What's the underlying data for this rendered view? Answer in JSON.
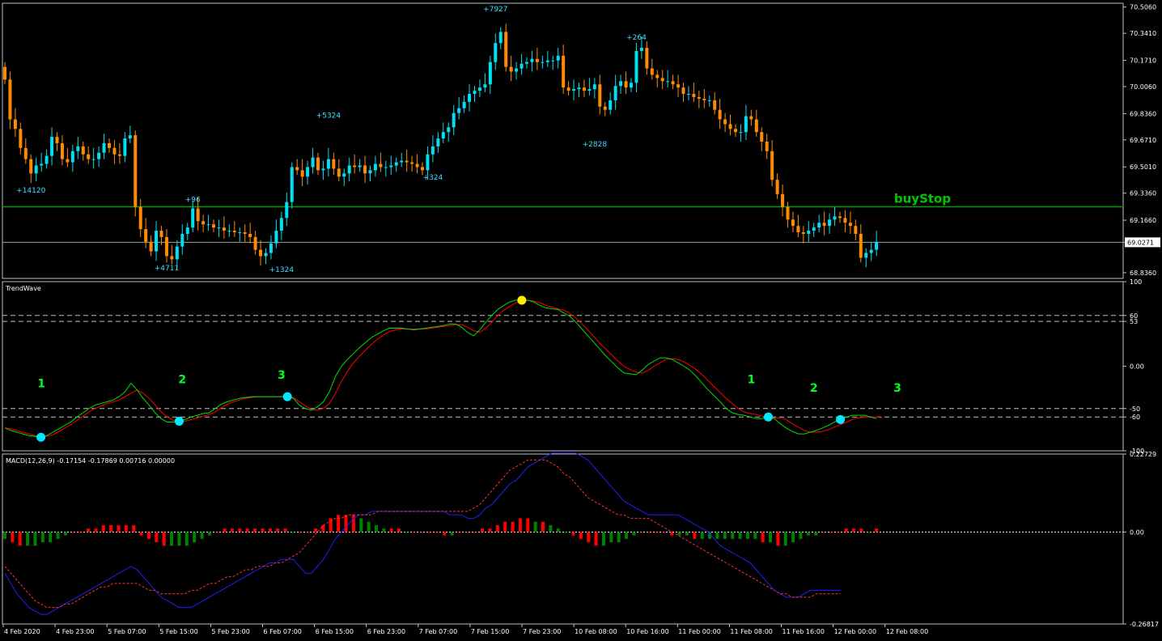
{
  "window": {
    "symbol_label": "EURRUB.ffx,H1  69.0034 69.0912 69.0032 69.0271"
  },
  "colors": {
    "bull": "#00e0f0",
    "bear": "#ff8c00",
    "grid": "#c0c0c0",
    "buystop": "#00a000",
    "trend_green": "#00e000",
    "trend_red": "#ff0000",
    "macd_blue": "#2020ff",
    "macd_red": "#ff3030",
    "hist_green": "#008000",
    "hist_red": "#ff0000",
    "dot_cyan": "#00e8ff",
    "dot_yellow": "#ffee00",
    "wave_label": "#00ff20"
  },
  "price_panel": {
    "ticks": [
      "70.5060",
      "70.3410",
      "70.1710",
      "70.0060",
      "69.8360",
      "69.6710",
      "69.5010",
      "69.3360",
      "69.1660",
      "69.0271",
      "68.8360"
    ],
    "ylim": [
      68.8,
      70.53
    ],
    "current_price": 69.0271,
    "current_label": "69.0271",
    "buystop_price": 69.25,
    "buystop_label": "buyStop",
    "trade_labels": [
      {
        "text": "+14120",
        "price": 69.34,
        "bar": 5
      },
      {
        "text": "+96",
        "price": 69.28,
        "bar": 36
      },
      {
        "text": "+4711",
        "price": 68.85,
        "bar": 31
      },
      {
        "text": "+1324",
        "price": 68.84,
        "bar": 53
      },
      {
        "text": "+5324",
        "price": 69.81,
        "bar": 62
      },
      {
        "text": "+324",
        "price": 69.42,
        "bar": 82
      },
      {
        "text": "+7927",
        "price": 70.48,
        "bar": 94
      },
      {
        "text": "+264",
        "price": 70.3,
        "bar": 121
      },
      {
        "text": "+2828",
        "price": 69.63,
        "bar": 113
      }
    ]
  },
  "trendwave_panel": {
    "title": "TrendWave",
    "ticks": [
      "100",
      "60",
      "53",
      "0.00",
      "-50",
      "-60",
      "-100"
    ],
    "ylim": [
      -100,
      100
    ],
    "levels": [
      60,
      53,
      -50,
      -60
    ],
    "wave_labels": [
      {
        "text": "1",
        "bar": 7,
        "value": -25
      },
      {
        "text": "2",
        "bar": 34,
        "value": -20
      },
      {
        "text": "3",
        "bar": 53,
        "value": -15
      },
      {
        "text": "1",
        "bar": 143,
        "value": -20
      },
      {
        "text": "2",
        "bar": 155,
        "value": -30
      },
      {
        "text": "3",
        "bar": 171,
        "value": -30
      }
    ]
  },
  "macd_panel": {
    "title": "MACD(12,26,9) -0.17154 -0.17869 0.00716 0.00000",
    "ticks": [
      "0.22729",
      "0.00",
      "-0.26817"
    ],
    "ylim": [
      -0.26817,
      0.22729
    ]
  },
  "x_axis": {
    "labels": [
      "4 Feb 2020",
      "4 Feb 23:00",
      "5 Feb 07:00",
      "5 Feb 15:00",
      "5 Feb 23:00",
      "6 Feb 07:00",
      "6 Feb 15:00",
      "6 Feb 23:00",
      "7 Feb 07:00",
      "7 Feb 15:00",
      "7 Feb 23:00",
      "10 Feb 08:00",
      "10 Feb 16:00",
      "11 Feb 00:00",
      "11 Feb 08:00",
      "11 Feb 16:00",
      "12 Feb 00:00",
      "12 Feb 08:00"
    ]
  },
  "chart_data": [
    {
      "type": "candlestick",
      "title": "EURRUB.ffx,H1  69.0034 69.0912 69.0032 69.0271",
      "ylim": [
        68.8,
        70.53
      ],
      "close": [
        70.05,
        69.8,
        69.74,
        69.62,
        69.55,
        69.46,
        69.51,
        69.52,
        69.57,
        69.69,
        69.65,
        69.55,
        69.53,
        69.6,
        69.63,
        69.58,
        69.55,
        69.55,
        69.59,
        69.65,
        69.62,
        69.58,
        69.57,
        69.68,
        69.7,
        69.25,
        69.11,
        69.03,
        68.97,
        69.1,
        69.06,
        68.94,
        68.92,
        69.0,
        69.08,
        69.12,
        69.24,
        69.16,
        69.14,
        69.14,
        69.12,
        69.12,
        69.1,
        69.1,
        69.09,
        69.09,
        69.08,
        69.06,
        68.98,
        68.94,
        68.96,
        69.02,
        69.1,
        69.18,
        69.28,
        69.5,
        69.48,
        69.44,
        69.5,
        69.56,
        69.48,
        69.49,
        69.55,
        69.49,
        69.44,
        69.46,
        69.51,
        69.5,
        69.51,
        69.46,
        69.48,
        69.52,
        69.5,
        69.5,
        69.51,
        69.53,
        69.54,
        69.53,
        69.52,
        69.5,
        69.48,
        69.58,
        69.63,
        69.68,
        69.72,
        69.75,
        69.84,
        69.87,
        69.91,
        69.96,
        69.98,
        70.0,
        70.02,
        70.16,
        70.28,
        70.35,
        70.13,
        70.1,
        70.12,
        70.15,
        70.16,
        70.18,
        70.16,
        70.16,
        70.17,
        70.17,
        70.2,
        70.0,
        69.98,
        69.99,
        70.0,
        69.98,
        69.99,
        70.02,
        69.88,
        69.86,
        69.92,
        70.01,
        70.04,
        70.0,
        70.03,
        70.23,
        70.25,
        70.12,
        70.08,
        70.06,
        70.04,
        70.04,
        70.02,
        70.0,
        69.96,
        69.96,
        69.94,
        69.93,
        69.92,
        69.92,
        69.86,
        69.8,
        69.77,
        69.74,
        69.72,
        69.72,
        69.82,
        69.8,
        69.72,
        69.66,
        69.6,
        69.42,
        69.33,
        69.25,
        69.17,
        69.13,
        69.09,
        69.08,
        69.1,
        69.12,
        69.15,
        69.13,
        69.17,
        69.19,
        69.18,
        69.15,
        69.13,
        69.08,
        68.93,
        68.96,
        68.98,
        69.03
      ],
      "series": [
        {
          "name": "TrendWave green",
          "values": [
            -73,
            -76,
            -78,
            -80,
            -82,
            -83,
            -84,
            -82,
            -78,
            -74,
            -70,
            -66,
            -60,
            -55,
            -50,
            -46,
            -44,
            -42,
            -40,
            -36,
            -30,
            -20,
            -28,
            -38,
            -46,
            -55,
            -62,
            -66,
            -66,
            -65,
            -63,
            -60,
            -58,
            -56,
            -55,
            -50,
            -45,
            -42,
            -40,
            -38,
            -37,
            -36,
            -36,
            -36,
            -36,
            -36,
            -36,
            -36,
            -38,
            -46,
            -50,
            -52,
            -48,
            -42,
            -30,
            -12,
            0,
            8,
            15,
            22,
            28,
            34,
            38,
            42,
            45,
            45,
            45,
            44,
            43,
            44,
            45,
            46,
            47,
            48,
            50,
            50,
            46,
            40,
            36,
            43,
            52,
            60,
            67,
            72,
            76,
            78,
            78,
            78,
            76,
            72,
            69,
            68,
            67,
            63,
            59,
            52,
            44,
            36,
            28,
            20,
            12,
            5,
            -2,
            -8,
            -9,
            -10,
            -5,
            2,
            6,
            10,
            10,
            8,
            4,
            0,
            -5,
            -12,
            -20,
            -28,
            -35,
            -42,
            -50,
            -55,
            -57,
            -58,
            -60,
            -62,
            -62,
            -60,
            -62,
            -68,
            -73,
            -77,
            -80,
            -80,
            -78,
            -76,
            -73,
            -70,
            -66,
            -63,
            -60,
            -58,
            -58,
            -58,
            -60,
            -62
          ],
          "color": "#00e000"
        },
        {
          "name": "TrendWave red",
          "values": [
            -73,
            -74,
            -76,
            -78,
            -80,
            -82,
            -82,
            -83,
            -81,
            -77,
            -73,
            -69,
            -64,
            -59,
            -54,
            -50,
            -47,
            -44,
            -42,
            -40,
            -36,
            -32,
            -28,
            -32,
            -38,
            -46,
            -54,
            -60,
            -64,
            -65,
            -65,
            -63,
            -61,
            -59,
            -57,
            -54,
            -49,
            -45,
            -42,
            -40,
            -38,
            -37,
            -36,
            -36,
            -36,
            -36,
            -36,
            -36,
            -37,
            -42,
            -47,
            -51,
            -52,
            -50,
            -44,
            -32,
            -18,
            -6,
            4,
            12,
            19,
            26,
            32,
            37,
            41,
            43,
            44,
            44,
            44,
            44,
            44,
            45,
            46,
            47,
            48,
            49,
            49,
            46,
            42,
            40,
            45,
            52,
            60,
            66,
            71,
            75,
            77,
            78,
            77,
            75,
            72,
            70,
            68,
            66,
            62,
            57,
            50,
            43,
            35,
            27,
            20,
            13,
            6,
            0,
            -4,
            -7,
            -8,
            -5,
            0,
            4,
            8,
            9,
            8,
            5,
            1,
            -4,
            -10,
            -17,
            -24,
            -31,
            -38,
            -44,
            -50,
            -54,
            -56,
            -57,
            -59,
            -61,
            -61,
            -61,
            -63,
            -68,
            -72,
            -76,
            -78,
            -78,
            -77,
            -75,
            -72,
            -69,
            -66,
            -63,
            -61,
            -60,
            -60,
            -60,
            -61
          ],
          "color": "#ff0000"
        },
        {
          "name": "MACD main",
          "values": [
            -0.12,
            -0.15,
            -0.18,
            -0.2,
            -0.22,
            -0.23,
            -0.24,
            -0.24,
            -0.23,
            -0.22,
            -0.21,
            -0.2,
            -0.19,
            -0.18,
            -0.17,
            -0.16,
            -0.15,
            -0.14,
            -0.13,
            -0.12,
            -0.11,
            -0.1,
            -0.11,
            -0.13,
            -0.15,
            -0.17,
            -0.19,
            -0.2,
            -0.21,
            -0.22,
            -0.22,
            -0.22,
            -0.21,
            -0.2,
            -0.19,
            -0.18,
            -0.17,
            -0.16,
            -0.15,
            -0.14,
            -0.13,
            -0.12,
            -0.11,
            -0.1,
            -0.09,
            -0.09,
            -0.08,
            -0.08,
            -0.08,
            -0.1,
            -0.12,
            -0.12,
            -0.1,
            -0.08,
            -0.05,
            -0.02,
            0.0,
            0.02,
            0.04,
            0.05,
            0.05,
            0.06,
            0.06,
            0.06,
            0.06,
            0.06,
            0.06,
            0.06,
            0.06,
            0.06,
            0.06,
            0.06,
            0.06,
            0.06,
            0.05,
            0.05,
            0.05,
            0.04,
            0.04,
            0.05,
            0.07,
            0.08,
            0.1,
            0.12,
            0.14,
            0.15,
            0.17,
            0.19,
            0.2,
            0.21,
            0.22,
            0.23,
            0.23,
            0.23,
            0.23,
            0.23,
            0.22,
            0.21,
            0.19,
            0.17,
            0.15,
            0.13,
            0.11,
            0.09,
            0.08,
            0.07,
            0.06,
            0.05,
            0.05,
            0.05,
            0.05,
            0.05,
            0.05,
            0.04,
            0.03,
            0.02,
            0.01,
            0.0,
            -0.02,
            -0.04,
            -0.05,
            -0.06,
            -0.07,
            -0.08,
            -0.09,
            -0.11,
            -0.13,
            -0.15,
            -0.17,
            -0.18,
            -0.19,
            -0.19,
            -0.19,
            -0.18,
            -0.17,
            -0.17,
            -0.17,
            -0.17,
            -0.17,
            -0.17
          ],
          "color": "#2020ff"
        },
        {
          "name": "MACD signal",
          "values": [
            -0.1,
            -0.12,
            -0.14,
            -0.16,
            -0.18,
            -0.2,
            -0.21,
            -0.22,
            -0.22,
            -0.22,
            -0.21,
            -0.21,
            -0.2,
            -0.19,
            -0.18,
            -0.17,
            -0.16,
            -0.16,
            -0.15,
            -0.15,
            -0.15,
            -0.15,
            -0.15,
            -0.16,
            -0.17,
            -0.17,
            -0.18,
            -0.18,
            -0.18,
            -0.18,
            -0.18,
            -0.17,
            -0.17,
            -0.16,
            -0.15,
            -0.15,
            -0.14,
            -0.13,
            -0.13,
            -0.12,
            -0.11,
            -0.11,
            -0.1,
            -0.1,
            -0.1,
            -0.09,
            -0.09,
            -0.08,
            -0.07,
            -0.06,
            -0.04,
            -0.02,
            0.0,
            0.02,
            0.03,
            0.04,
            0.04,
            0.05,
            0.05,
            0.05,
            0.05,
            0.05,
            0.06,
            0.06,
            0.06,
            0.06,
            0.06,
            0.06,
            0.06,
            0.06,
            0.06,
            0.06,
            0.06,
            0.06,
            0.06,
            0.06,
            0.06,
            0.06,
            0.07,
            0.08,
            0.1,
            0.12,
            0.14,
            0.16,
            0.18,
            0.19,
            0.2,
            0.21,
            0.21,
            0.21,
            0.21,
            0.2,
            0.19,
            0.17,
            0.16,
            0.14,
            0.12,
            0.1,
            0.09,
            0.08,
            0.07,
            0.06,
            0.05,
            0.05,
            0.04,
            0.04,
            0.04,
            0.04,
            0.03,
            0.02,
            0.01,
            0.0,
            -0.01,
            -0.02,
            -0.03,
            -0.04,
            -0.05,
            -0.06,
            -0.07,
            -0.08,
            -0.09,
            -0.1,
            -0.11,
            -0.12,
            -0.13,
            -0.14,
            -0.15,
            -0.16,
            -0.17,
            -0.18,
            -0.18,
            -0.19,
            -0.19,
            -0.19,
            -0.19,
            -0.18,
            -0.18,
            -0.18,
            -0.18,
            -0.18
          ],
          "color": "#ff3030"
        },
        {
          "name": "MACD histogram",
          "values": [
            -0.02,
            -0.03,
            -0.04,
            -0.04,
            -0.04,
            -0.03,
            -0.03,
            -0.02,
            -0.01,
            0.0,
            0.0,
            0.01,
            0.01,
            0.02,
            0.02,
            0.02,
            0.02,
            0.02,
            -0.01,
            -0.02,
            -0.03,
            -0.04,
            -0.04,
            -0.04,
            -0.04,
            -0.03,
            -0.02,
            -0.01,
            0.0,
            0.01,
            0.01,
            0.01,
            0.01,
            0.01,
            0.01,
            0.01,
            0.01,
            0.01,
            0.0,
            0.0,
            0.0,
            0.01,
            0.02,
            0.04,
            0.05,
            0.05,
            0.05,
            0.04,
            0.03,
            0.02,
            0.01,
            0.01,
            0.01,
            0.0,
            0.0,
            0.0,
            0.0,
            0.0,
            -0.01,
            -0.01,
            0.0,
            0.0,
            0.0,
            0.01,
            0.01,
            0.02,
            0.03,
            0.03,
            0.04,
            0.04,
            0.03,
            0.03,
            0.02,
            0.01,
            0.0,
            -0.01,
            -0.02,
            -0.03,
            -0.04,
            -0.04,
            -0.03,
            -0.03,
            -0.02,
            -0.01,
            0.0,
            0.0,
            0.0,
            0.0,
            -0.01,
            -0.01,
            -0.01,
            -0.02,
            -0.02,
            -0.02,
            -0.02,
            -0.02,
            -0.02,
            -0.02,
            -0.02,
            -0.02,
            -0.03,
            -0.03,
            -0.04,
            -0.04,
            -0.03,
            -0.02,
            -0.01,
            -0.01,
            0.0,
            0.0,
            0.0,
            0.01,
            0.01,
            0.01,
            0.0,
            0.01
          ],
          "color": "#008000"
        }
      ]
    }
  ]
}
